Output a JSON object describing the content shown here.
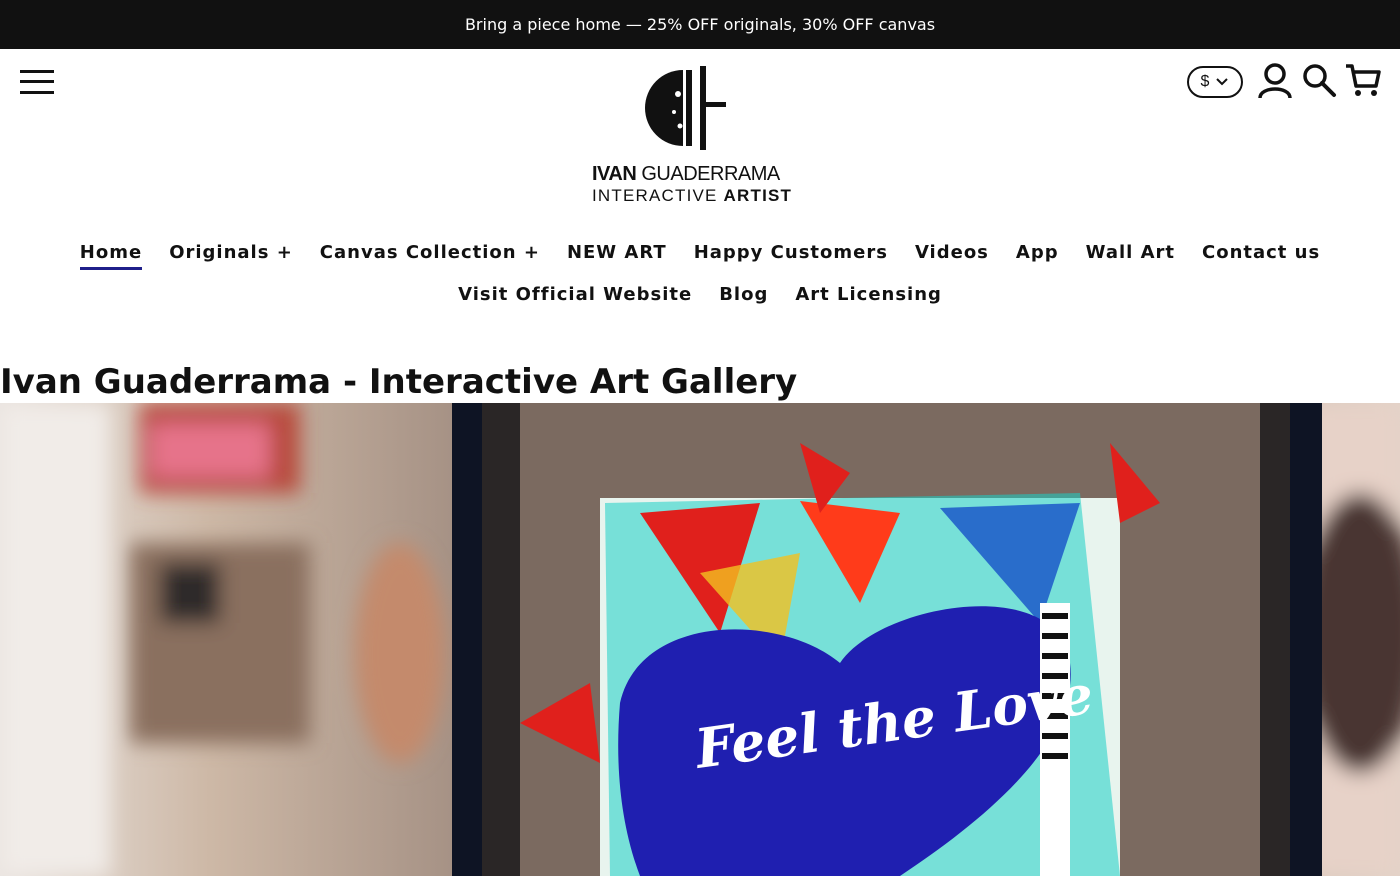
{
  "announcement": {
    "text": "Bring a piece home — 25% OFF originals, 30% OFF canvas"
  },
  "header": {
    "logo": {
      "name_bold": "IVAN",
      "name_rest": "GUADERRAMA",
      "tag_rest": "INTERACTIVE",
      "tag_bold": "ARTIST"
    },
    "currency_symbol": "$",
    "icons": [
      "menu-icon",
      "account-icon",
      "search-icon",
      "cart-icon"
    ]
  },
  "nav": {
    "row1": [
      {
        "label": "Home",
        "active": true
      },
      {
        "label": "Originals +"
      },
      {
        "label": "Canvas Collection +"
      },
      {
        "label": "NEW ART"
      },
      {
        "label": "Happy Customers"
      },
      {
        "label": "Videos"
      },
      {
        "label": "App"
      },
      {
        "label": "Wall Art"
      },
      {
        "label": "Contact us"
      }
    ],
    "row2": [
      {
        "label": "Visit Official Website"
      },
      {
        "label": "Blog"
      },
      {
        "label": "Art Licensing"
      }
    ]
  },
  "main": {
    "page_title": "Ivan Guaderrama - Interactive Art Gallery",
    "hero": {
      "artwork_text": "Feel the Love"
    }
  },
  "colors": {
    "announcement_bg": "#111111",
    "nav_active_underline": "#1f1f8a",
    "artwork_heart": "#1f1fb0"
  }
}
